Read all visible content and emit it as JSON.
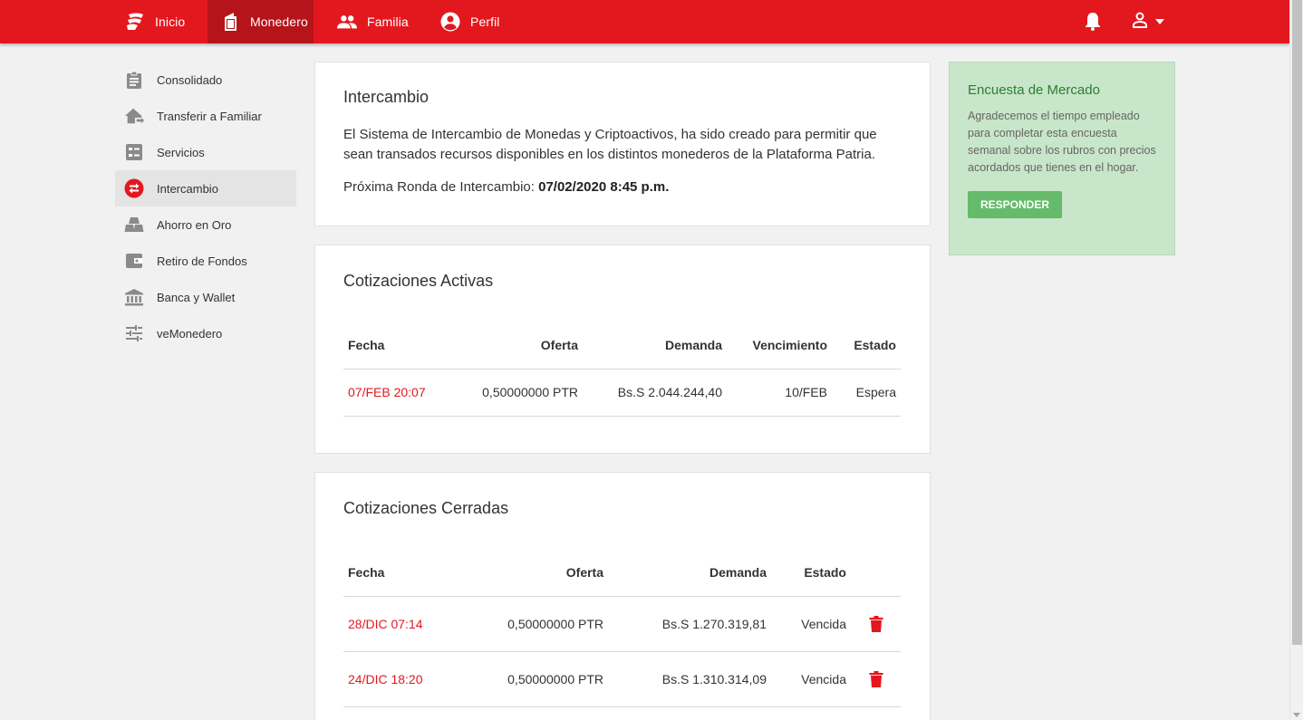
{
  "topnav": {
    "items": [
      {
        "label": "Inicio",
        "icon": "patria-logo-icon"
      },
      {
        "label": "Monedero",
        "icon": "wallet-icon"
      },
      {
        "label": "Familia",
        "icon": "people-icon"
      },
      {
        "label": "Perfil",
        "icon": "account-circle-icon"
      }
    ],
    "active_index": 1,
    "bar_color": "#e3181e",
    "active_color": "#b5141a"
  },
  "sidebar": {
    "items": [
      {
        "label": "Consolidado",
        "icon": "clipboard-icon"
      },
      {
        "label": "Transferir a Familiar",
        "icon": "house-transfer-icon"
      },
      {
        "label": "Servicios",
        "icon": "services-icon"
      },
      {
        "label": "Intercambio",
        "icon": "exchange-icon"
      },
      {
        "label": "Ahorro en Oro",
        "icon": "gold-bars-icon"
      },
      {
        "label": "Retiro de Fondos",
        "icon": "wallet-icon"
      },
      {
        "label": "Banca y Wallet",
        "icon": "bank-icon"
      },
      {
        "label": "veMonedero",
        "icon": "tune-sliders-icon"
      }
    ],
    "active_index": 3
  },
  "intercambio": {
    "title": "Intercambio",
    "description": "El Sistema de Intercambio de Monedas y Criptoactivos, ha sido creado para permitir que sean transados recursos disponibles en los distintos monederos de la Plataforma Patria.",
    "next_round_label": "Próxima Ronda de Intercambio:",
    "next_round_value": "07/02/2020 8:45 p.m."
  },
  "activas": {
    "title": "Cotizaciones Activas",
    "headers": [
      "Fecha",
      "Oferta",
      "Demanda",
      "Vencimiento",
      "Estado"
    ],
    "rows": [
      {
        "fecha": "07/FEB 20:07",
        "oferta": "0,50000000 PTR",
        "demanda": "Bs.S 2.044.244,40",
        "vencimiento": "10/FEB",
        "estado": "Espera"
      }
    ]
  },
  "cerradas": {
    "title": "Cotizaciones Cerradas",
    "headers": [
      "Fecha",
      "Oferta",
      "Demanda",
      "Estado"
    ],
    "rows": [
      {
        "fecha": "28/DIC 07:14",
        "oferta": "0,50000000 PTR",
        "demanda": "Bs.S 1.270.319,81",
        "estado": "Vencida"
      },
      {
        "fecha": "24/DIC 18:20",
        "oferta": "0,50000000 PTR",
        "demanda": "Bs.S 1.310.314,09",
        "estado": "Vencida"
      }
    ]
  },
  "survey": {
    "title": "Encuesta de Mercado",
    "text": "Agradecemos el tiempo empleado para completar esta encuesta semanal sobre los rubros con precios acordados que tienes en el hogar.",
    "button": "RESPONDER"
  },
  "colors": {
    "accent": "#e3181e",
    "survey_bg": "#c8e6c9",
    "survey_button": "#66bb6a",
    "survey_title": "#2e7d32"
  }
}
